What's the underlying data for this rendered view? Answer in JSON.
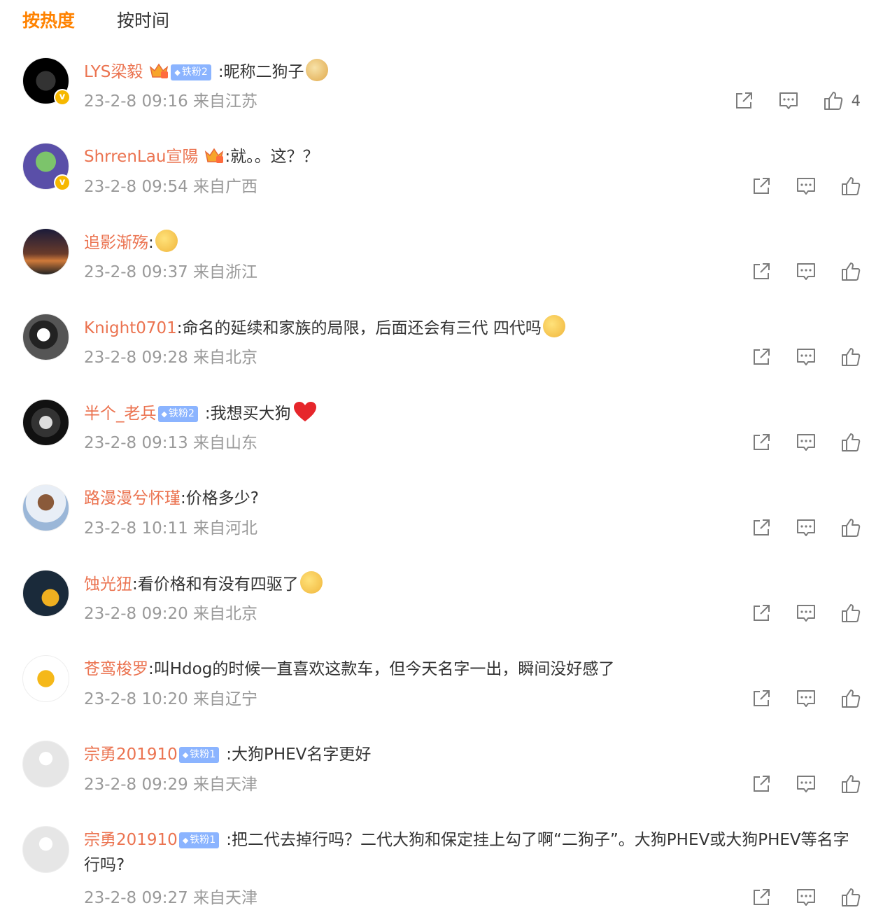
{
  "tabs": [
    {
      "label": "按热度",
      "active": true
    },
    {
      "label": "按时间",
      "active": false
    }
  ],
  "colors": {
    "accent": "#ff8200",
    "username": "#eb7350",
    "meta": "#999999",
    "fan_badge": "#8bb4ff"
  },
  "comments": [
    {
      "user": "LYS梁毅",
      "verified": true,
      "crown": true,
      "fan": "铁粉2",
      "text": ":昵称二狗子",
      "emoji": "doge-emoji",
      "time": "23-2-8 09:16",
      "location": "来自江苏",
      "likes": "4"
    },
    {
      "user": "ShrrenLau宣陽",
      "verified": true,
      "crown": true,
      "fan": "",
      "text": ":就。。这？？",
      "emoji": "",
      "time": "23-2-8 09:54",
      "location": "来自广西",
      "likes": ""
    },
    {
      "user": "追影渐殇",
      "verified": false,
      "crown": false,
      "fan": "",
      "text": ":",
      "emoji": "cry-laugh-emoji",
      "time": "23-2-8 09:37",
      "location": "来自浙江",
      "likes": ""
    },
    {
      "user": "Knight0701",
      "verified": false,
      "crown": false,
      "fan": "",
      "text": ":命名的延续和家族的局限，后面还会有三代 四代吗",
      "emoji": "laugh-tears-emoji",
      "time": "23-2-8 09:28",
      "location": "来自北京",
      "likes": ""
    },
    {
      "user": "半个_老兵",
      "verified": false,
      "crown": false,
      "fan": "铁粉2",
      "text": ":我想买大狗",
      "emoji": "heart-emoji",
      "time": "23-2-8 09:13",
      "location": "来自山东",
      "likes": ""
    },
    {
      "user": "路漫漫兮怀瑾",
      "verified": false,
      "crown": false,
      "fan": "",
      "text": ":价格多少?",
      "emoji": "",
      "time": "23-2-8 10:11",
      "location": "来自河北",
      "likes": ""
    },
    {
      "user": "蚀光狃",
      "verified": false,
      "crown": false,
      "fan": "",
      "text": ":看价格和有没有四驱了",
      "emoji": "glasses-emoji",
      "time": "23-2-8 09:20",
      "location": "来自北京",
      "likes": ""
    },
    {
      "user": "苍鸾梭罗",
      "verified": false,
      "crown": false,
      "fan": "",
      "text": ":叫Hdog的时候一直喜欢这款车，但今天名字一出，瞬间没好感了",
      "emoji": "",
      "time": "23-2-8 10:20",
      "location": "来自辽宁",
      "likes": ""
    },
    {
      "user": "宗勇201910",
      "verified": false,
      "crown": false,
      "fan": "铁粉1",
      "text": ":大狗PHEV名字更好",
      "emoji": "",
      "time": "23-2-8 09:29",
      "location": "来自天津",
      "likes": ""
    },
    {
      "user": "宗勇201910",
      "verified": false,
      "crown": false,
      "fan": "铁粉1",
      "text": ":把二代去掉行吗？二代大狗和保定挂上勾了啊“二狗子”。大狗PHEV或大狗PHEV等名字行吗?",
      "emoji": "",
      "time": "23-2-8 09:27",
      "location": "来自天津",
      "likes": ""
    }
  ]
}
